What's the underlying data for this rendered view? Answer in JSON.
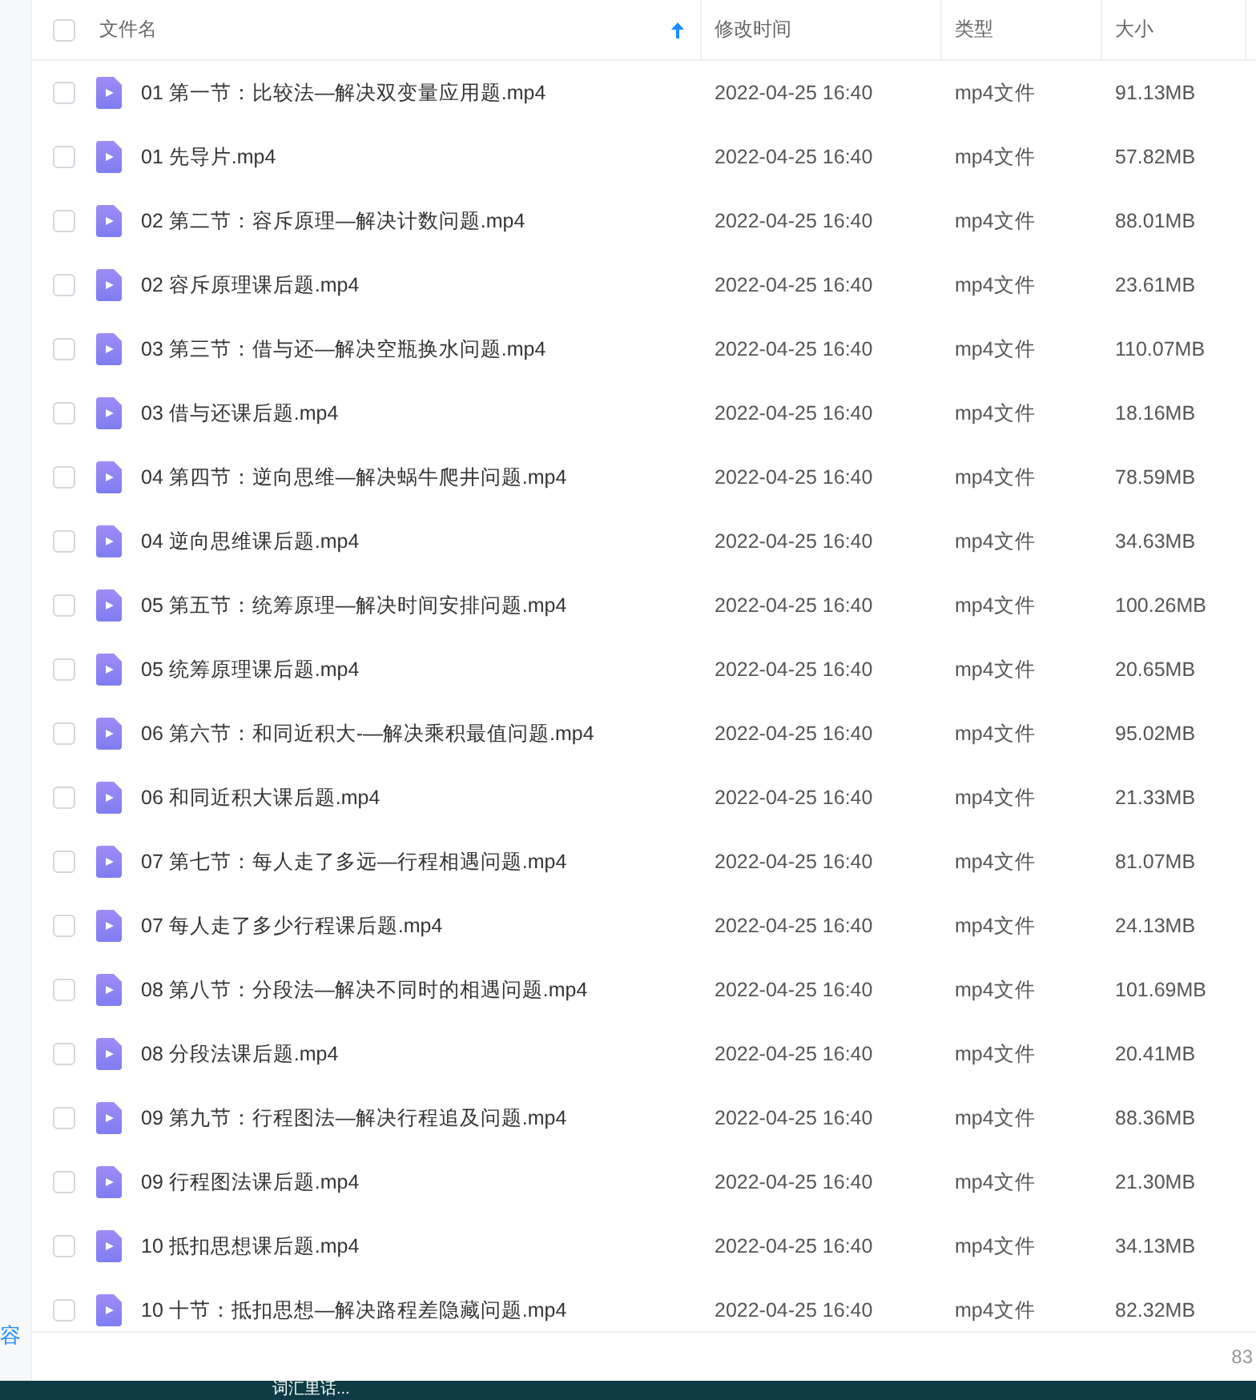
{
  "table": {
    "header_checked": false,
    "columns": [
      {
        "label": "文件名",
        "sorted": true
      },
      {
        "label": "修改时间",
        "sorted": false
      },
      {
        "label": "类型",
        "sorted": false
      },
      {
        "label": "大小",
        "sorted": false
      }
    ],
    "rows": [
      {
        "checked": false,
        "name": "01 第一节：比较法—解决双变量应用题.mp4",
        "modified": "2022-04-25 16:40",
        "type": "mp4文件",
        "size": "91.13MB"
      },
      {
        "checked": false,
        "name": "01 先导片.mp4",
        "modified": "2022-04-25 16:40",
        "type": "mp4文件",
        "size": "57.82MB"
      },
      {
        "checked": false,
        "name": "02 第二节：容斥原理—解决计数问题.mp4",
        "modified": "2022-04-25 16:40",
        "type": "mp4文件",
        "size": "88.01MB"
      },
      {
        "checked": false,
        "name": "02 容斥原理课后题.mp4",
        "modified": "2022-04-25 16:40",
        "type": "mp4文件",
        "size": "23.61MB"
      },
      {
        "checked": false,
        "name": "03 第三节：借与还—解决空瓶换水问题.mp4",
        "modified": "2022-04-25 16:40",
        "type": "mp4文件",
        "size": "110.07MB"
      },
      {
        "checked": false,
        "name": "03 借与还课后题.mp4",
        "modified": "2022-04-25 16:40",
        "type": "mp4文件",
        "size": "18.16MB"
      },
      {
        "checked": false,
        "name": "04 第四节：逆向思维—解决蜗牛爬井问题.mp4",
        "modified": "2022-04-25 16:40",
        "type": "mp4文件",
        "size": "78.59MB"
      },
      {
        "checked": false,
        "name": "04 逆向思维课后题.mp4",
        "modified": "2022-04-25 16:40",
        "type": "mp4文件",
        "size": "34.63MB"
      },
      {
        "checked": false,
        "name": "05 第五节：统筹原理—解决时间安排问题.mp4",
        "modified": "2022-04-25 16:40",
        "type": "mp4文件",
        "size": "100.26MB"
      },
      {
        "checked": false,
        "name": "05 统筹原理课后题.mp4",
        "modified": "2022-04-25 16:40",
        "type": "mp4文件",
        "size": "20.65MB"
      },
      {
        "checked": false,
        "name": "06 第六节：和同近积大-—解决乘积最值问题.mp4",
        "modified": "2022-04-25 16:40",
        "type": "mp4文件",
        "size": "95.02MB"
      },
      {
        "checked": false,
        "name": "06 和同近积大课后题.mp4",
        "modified": "2022-04-25 16:40",
        "type": "mp4文件",
        "size": "21.33MB"
      },
      {
        "checked": false,
        "name": "07 第七节：每人走了多远—行程相遇问题.mp4",
        "modified": "2022-04-25 16:40",
        "type": "mp4文件",
        "size": "81.07MB"
      },
      {
        "checked": false,
        "name": "07 每人走了多少行程课后题.mp4",
        "modified": "2022-04-25 16:40",
        "type": "mp4文件",
        "size": "24.13MB"
      },
      {
        "checked": false,
        "name": "08 第八节：分段法—解决不同时的相遇问题.mp4",
        "modified": "2022-04-25 16:40",
        "type": "mp4文件",
        "size": "101.69MB"
      },
      {
        "checked": false,
        "name": "08 分段法课后题.mp4",
        "modified": "2022-04-25 16:40",
        "type": "mp4文件",
        "size": "20.41MB"
      },
      {
        "checked": false,
        "name": "09 第九节：行程图法—解决行程追及问题.mp4",
        "modified": "2022-04-25 16:40",
        "type": "mp4文件",
        "size": "88.36MB"
      },
      {
        "checked": false,
        "name": "09 行程图法课后题.mp4",
        "modified": "2022-04-25 16:40",
        "type": "mp4文件",
        "size": "21.30MB"
      },
      {
        "checked": false,
        "name": "10 抵扣思想课后题.mp4",
        "modified": "2022-04-25 16:40",
        "type": "mp4文件",
        "size": "34.13MB"
      },
      {
        "checked": false,
        "name": "10 十节：抵扣思想—解决路程差隐藏问题.mp4",
        "modified": "2022-04-25 16:40",
        "type": "mp4文件",
        "size": "82.32MB"
      }
    ]
  },
  "sidebar": {
    "label": "容"
  },
  "footer": {
    "count": "83"
  },
  "taskbar": {
    "text": "词汇里话..."
  }
}
